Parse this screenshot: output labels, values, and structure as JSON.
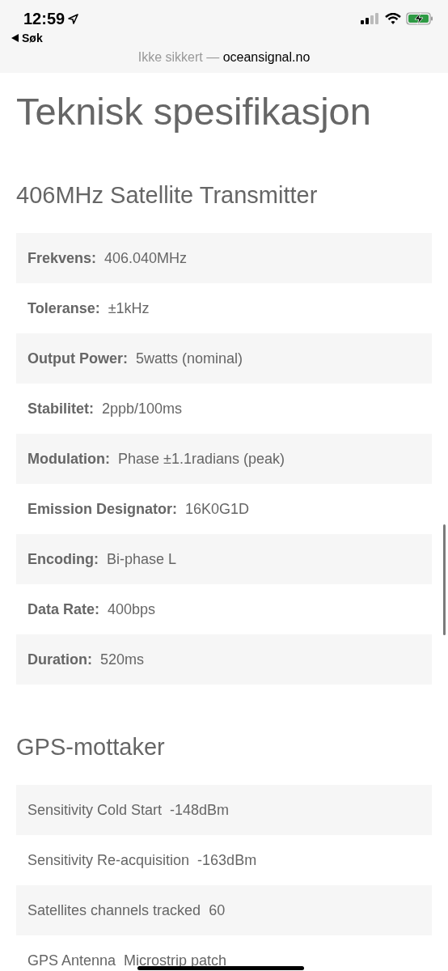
{
  "status_bar": {
    "time": "12:59",
    "back_label": "Søk"
  },
  "address_bar": {
    "security": "Ikke sikkert —",
    "domain": "oceansignal.no"
  },
  "page": {
    "title": "Teknisk spesifikasjon",
    "sections": [
      {
        "heading": "406MHz Satellite Transmitter",
        "kind": "bold-labels",
        "rows": [
          {
            "label": "Frekvens:",
            "value": "406.040MHz"
          },
          {
            "label": "Toleranse:",
            "value": "±1kHz"
          },
          {
            "label": "Output Power:",
            "value": "5watts (nominal)"
          },
          {
            "label": "Stabilitet:",
            "value": "2ppb/100ms"
          },
          {
            "label": "Modulation:",
            "value": "Phase ±1.1radians (peak)"
          },
          {
            "label": "Emission Designator:",
            "value": "16K0G1D"
          },
          {
            "label": "Encoding:",
            "value": "Bi-phase L"
          },
          {
            "label": "Data Rate:",
            "value": "400bps"
          },
          {
            "label": "Duration:",
            "value": "520ms"
          }
        ]
      },
      {
        "heading": "GPS-mottaker",
        "kind": "plain-labels",
        "rows": [
          {
            "label": "Sensitivity Cold Start",
            "value": "-148dBm"
          },
          {
            "label": "Sensitivity Re-acquisition",
            "value": "-163dBm"
          },
          {
            "label": "Satellites channels tracked",
            "value": "60"
          },
          {
            "label": "GPS Antenna",
            "value": "Microstrip patch"
          }
        ]
      }
    ]
  }
}
